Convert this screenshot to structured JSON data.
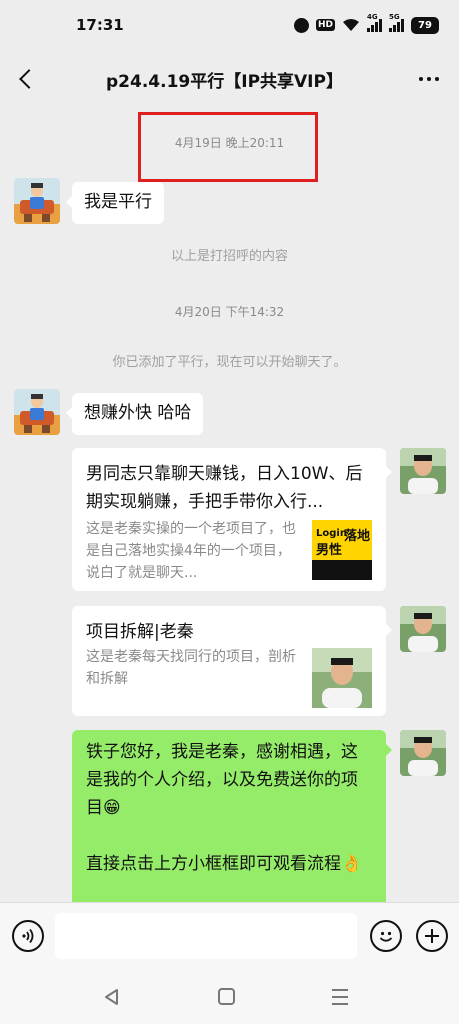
{
  "status_bar": {
    "time": "17:31",
    "icons": [
      "alarm-icon",
      "hd-icon",
      "wifi-icon",
      "signal-4g-icon",
      "signal-5g-icon",
      "battery-icon"
    ],
    "hd_label": "HD",
    "net1": "4G",
    "net2": "5G",
    "battery": "79"
  },
  "nav": {
    "title": "p24.4.19平行【IP共享VIP】",
    "back_icon": "chevron-left-icon",
    "more_icon": "more-dots-icon"
  },
  "chat": {
    "timestamp_1": "4月19日 晚上20:11",
    "msg_1": "我是平行",
    "system_1": "以上是打招呼的内容",
    "timestamp_2": "4月20日 下午14:32",
    "system_2": "你已添加了平行，现在可以开始聊天了。",
    "msg_2": "想赚外快 哈哈",
    "card_1": {
      "title": "男同志只靠聊天赚钱，日入10W、后期实现躺赚，手把手带你入行...",
      "desc": "这是老秦实操的一个老项目了，也是自己落地实操4年的一个项目，说白了就是聊天...",
      "thumb_text_1": "Login",
      "thumb_text_2": "男性",
      "thumb_text_3": "落地"
    },
    "card_2": {
      "title": "项目拆解|老秦",
      "desc": "这是老秦每天找同行的项目，剖析和拆解"
    },
    "msg_3_line_1": "铁子您好，我是老秦，感谢相遇，这是我的个人介绍，以及免费送你的项目😁",
    "msg_3_line_2": "直接点击上方小框框即可观看流程👌"
  },
  "input_bar": {
    "voice_icon": "voice-icon",
    "emoji_icon": "emoji-icon",
    "plus_icon": "plus-icon",
    "placeholder": ""
  },
  "system_nav": {
    "icons": [
      "nav-back-icon",
      "nav-home-icon",
      "nav-menu-icon"
    ]
  },
  "colors": {
    "background": "#ededed",
    "self_bubble": "#95ec69",
    "other_bubble": "#ffffff",
    "highlight": "#e02020",
    "thumb_yellow": "#ffd400"
  }
}
